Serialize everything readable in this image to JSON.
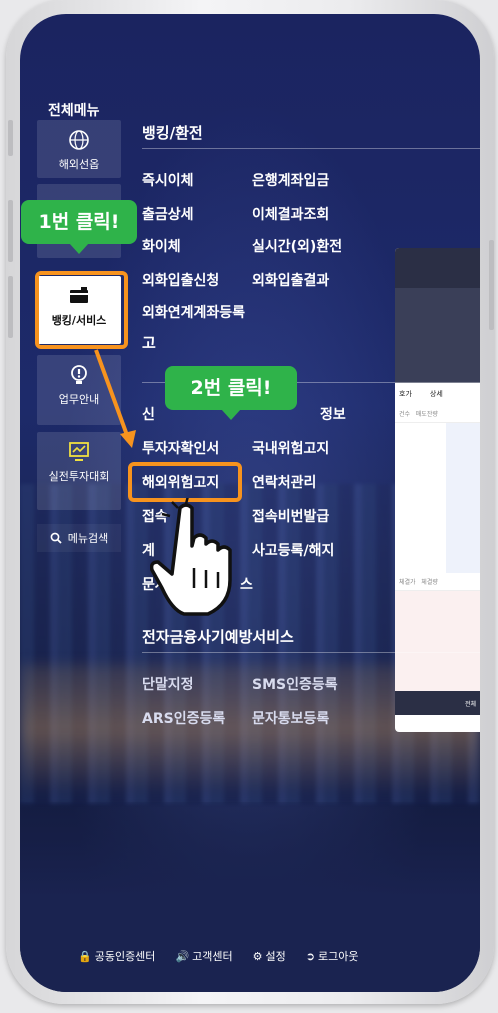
{
  "menu_title": "전체메뉴",
  "categories": [
    {
      "label": "해외선옵"
    },
    {
      "label": ""
    },
    {
      "label": "뱅킹/서비스"
    },
    {
      "label": "업무안내"
    },
    {
      "label": "실전투자대회"
    }
  ],
  "search_label": "메뉴검색",
  "sections": [
    {
      "title": "뱅킹/환전",
      "items": [
        "즉시이체",
        "은행계좌입금",
        "출금상세",
        "이체결과조회",
        "화이체",
        "실시간(외)환전",
        "외화입출신청",
        "외화입출결과",
        "외화연계계좌등록"
      ]
    },
    {
      "title": "고",
      "items": [
        "신",
        "정보",
        "투자자확인서",
        "국내위험고지",
        "해외위험고지",
        "연락처관리",
        "접속",
        "접속비번발급",
        "계",
        "사고등록/해지",
        "문자알",
        "스"
      ]
    },
    {
      "title": "전자금융사기예방서비스",
      "items": [
        "단말지정",
        "SMS인증등록",
        "ARS인증등록",
        "문자통보등록"
      ]
    }
  ],
  "callouts": {
    "step1": "1번 클릭!",
    "step2": "2번 클릭!"
  },
  "peek": {
    "tab1": "호가",
    "tab2": "상세",
    "row1a": "건수",
    "row1b": "매도잔량",
    "row2a": "체결가",
    "row2b": "체결량",
    "btn1": "전체"
  },
  "bottom_bar": [
    "공동인증센터",
    "고객센터",
    "설정",
    "로그아웃"
  ],
  "colors": {
    "highlight": "#f7931e",
    "bubble": "#2fb34a",
    "bg": "#1b2460"
  }
}
